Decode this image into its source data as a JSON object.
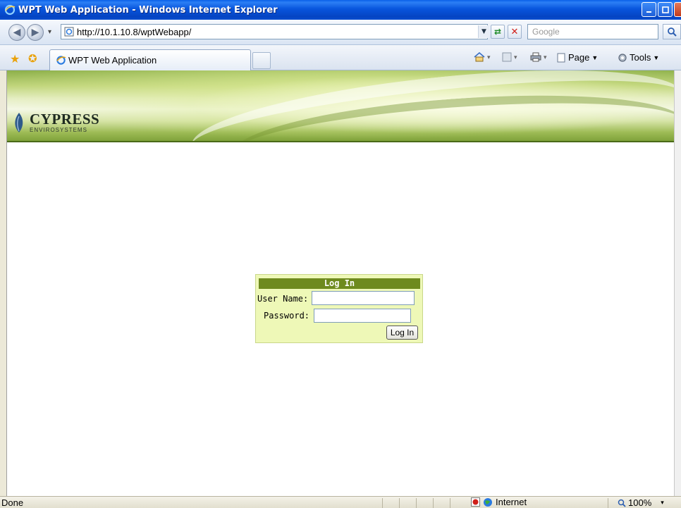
{
  "window": {
    "title": "WPT Web Application - Windows Internet Explorer"
  },
  "address_bar": {
    "url": "http://10.1.10.8/wptWebapp/",
    "search_placeholder": "Google"
  },
  "tabs": [
    {
      "label": "WPT Web Application"
    }
  ],
  "commands": {
    "page_label": "Page",
    "tools_label": "Tools"
  },
  "logo": {
    "name": "CYPRESS",
    "subtitle": "ENVIROSYSTEMS"
  },
  "login": {
    "title": "Log In",
    "username_label": "User Name:",
    "password_label": "Password:",
    "username_value": "",
    "password_value": "",
    "submit_label": "Log In"
  },
  "status_bar": {
    "status": "Done",
    "zone": "Internet",
    "zoom": "100%"
  },
  "colors": {
    "login_bg": "#EEF8B7",
    "login_header": "#6E8A1E",
    "banner_green": "#8DB04A",
    "title_blue": "#0A55DD"
  },
  "icons": [
    "ie-icon",
    "back-icon",
    "forward-icon",
    "refresh-icon",
    "stop-icon",
    "search-icon",
    "favorites-star-icon",
    "add-favorites-icon",
    "home-icon",
    "feeds-icon",
    "print-icon",
    "page-icon",
    "tools-icon",
    "globe-icon",
    "zoom-icon"
  ]
}
